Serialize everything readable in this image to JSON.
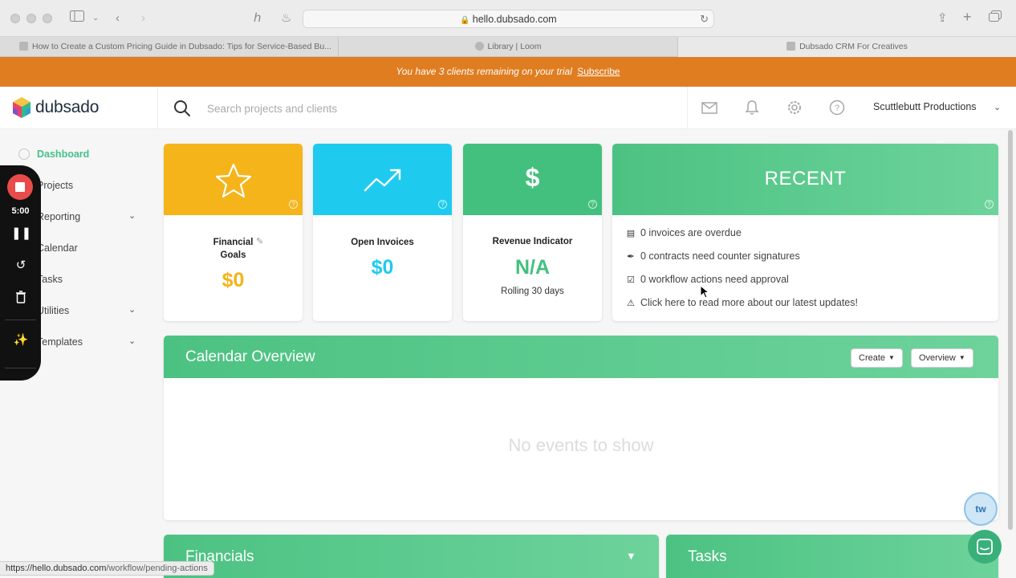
{
  "browser": {
    "url": "hello.dubsado.com",
    "tabs": [
      {
        "title": "How to Create a Custom Pricing Guide in Dubsado: Tips for Service-Based Bu..."
      },
      {
        "title": "Library | Loom"
      },
      {
        "title": "Dubsado CRM For Creatives"
      }
    ],
    "status_url_main": "https://hello.dubsado.com",
    "status_url_path": "/workflow/pending-actions"
  },
  "banner": {
    "message": "You have 3 clients remaining on your trial",
    "link": "Subscribe",
    "color": "#e07d21"
  },
  "header": {
    "logo_text": "dubsado",
    "search_placeholder": "Search projects and clients",
    "account_name": "Scuttlebutt Productions",
    "icons": [
      "search-icon",
      "mail-icon",
      "bell-icon",
      "gear-icon",
      "help-icon",
      "chevron-down-icon"
    ]
  },
  "sidebar": {
    "items": [
      {
        "label": "Dashboard",
        "active": true
      },
      {
        "label": "Projects"
      },
      {
        "label": "Reporting",
        "expandable": true
      },
      {
        "label": "Calendar"
      },
      {
        "label": "Tasks"
      },
      {
        "label": "Utilities",
        "expandable": true
      },
      {
        "label": "Templates",
        "expandable": true
      }
    ]
  },
  "loom": {
    "time": "5:00",
    "icons": [
      "stop-icon",
      "pause-icon",
      "restart-icon",
      "trash-icon",
      "magic-wand-icon"
    ]
  },
  "cards": {
    "financial": {
      "label_line1": "Financial",
      "label_line2": "Goals",
      "value": "$0",
      "color": "#f4b41a",
      "icon": "star-icon"
    },
    "invoices": {
      "label": "Open Invoices",
      "value": "$0",
      "color": "#1ecbef",
      "icon": "trend-up-icon"
    },
    "revenue": {
      "label": "Revenue Indicator",
      "value": "N/A",
      "sub": "Rolling 30 days",
      "color": "#44c07e",
      "icon_text": "$"
    },
    "recent": {
      "title": "RECENT",
      "rows": [
        {
          "text": "0 invoices are overdue",
          "icon": "document-icon"
        },
        {
          "text": "0 contracts need counter signatures",
          "icon": "pen-icon"
        },
        {
          "text": "0 workflow actions need approval",
          "icon": "checkbox-icon"
        },
        {
          "text": "Click here to read more about our latest updates!",
          "icon": "warning-icon"
        }
      ]
    }
  },
  "calendar": {
    "title": "Calendar Overview",
    "create_label": "Create",
    "overview_label": "Overview",
    "empty": "No events to show"
  },
  "financials": {
    "title": "Financials"
  },
  "tasks": {
    "title": "Tasks"
  },
  "widgets": {
    "tw_label": "tw"
  },
  "colors": {
    "accent_green": "#46c08a",
    "orange": "#e07d21",
    "yellow": "#f4b41a",
    "cyan": "#1ecbef"
  }
}
